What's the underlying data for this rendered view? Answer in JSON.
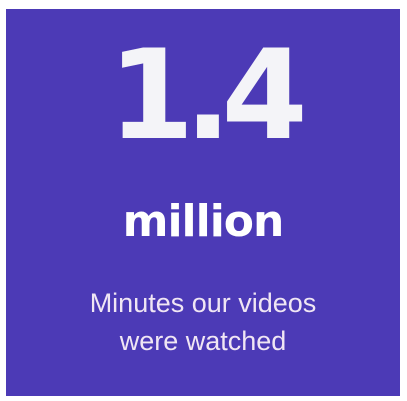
{
  "card": {
    "background_color": "#4c3ab6",
    "value": "1.4",
    "unit": "million",
    "caption_line1": "Minutes our videos",
    "caption_line2": "were watched"
  }
}
